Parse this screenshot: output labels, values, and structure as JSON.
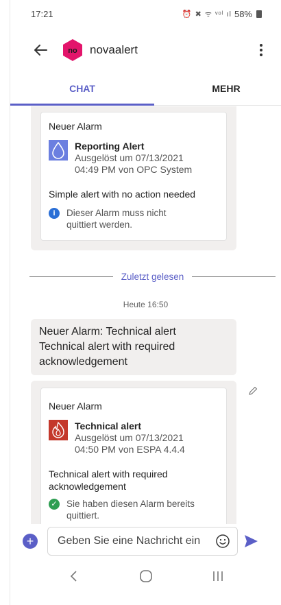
{
  "status_bar": {
    "time": "17:21",
    "icons": "⏰ ✖ ᯤ ᵛᵒˡ ıl",
    "battery": "58%"
  },
  "header": {
    "title": "novaalert",
    "avatar_text": "no"
  },
  "tabs": [
    {
      "label": "CHAT"
    },
    {
      "label": "MEHR"
    }
  ],
  "messages": {
    "card1": {
      "heading": "Neuer Alarm",
      "alert_title": "Reporting Alert",
      "alert_meta_line1": "Ausgelöst um 07/13/2021",
      "alert_meta_line2": "04:49 PM von OPC System",
      "description": "Simple alert with no action needed",
      "info_line1": "Dieser Alarm muss nicht",
      "info_line2": "quittiert werden."
    },
    "divider_label": "Zuletzt gelesen",
    "timestamp": "Heute 16:50",
    "text_message": {
      "line1": "Neuer Alarm: Technical alert",
      "line2": "Technical alert with required",
      "line3": "acknowledgement"
    },
    "card2": {
      "heading": "Neuer Alarm",
      "alert_title": "Technical alert",
      "alert_meta_line1": "Ausgelöst um 07/13/2021",
      "alert_meta_line2": "04:50 PM von ESPA 4.4.4",
      "description_line1": "Technical alert with required",
      "description_line2": "acknowledgement",
      "ack_line1": "Sie haben diesen Alarm bereits",
      "ack_line2": "quittiert."
    }
  },
  "composer": {
    "placeholder": "Geben Sie eine Nachricht ein"
  },
  "colors": {
    "accent": "#5b5fc7",
    "info": "#2b6fd6",
    "success": "#2e9e52",
    "avatar": "#e3156b",
    "reporting_icon_bg": "#6b7fe0",
    "technical_icon_bg": "#c4382b"
  },
  "icons": {
    "back": "arrow-left-icon",
    "more": "more-vertical-icon",
    "reporting": "water-drop-icon",
    "technical": "flame-icon",
    "info": "info-icon",
    "ack": "check-circle-icon",
    "edit": "pencil-icon",
    "add": "plus-icon",
    "emoji": "smiley-icon",
    "send": "send-icon",
    "nav_back": "chevron-left-icon",
    "nav_home": "home-icon",
    "nav_recent": "recent-apps-icon"
  }
}
